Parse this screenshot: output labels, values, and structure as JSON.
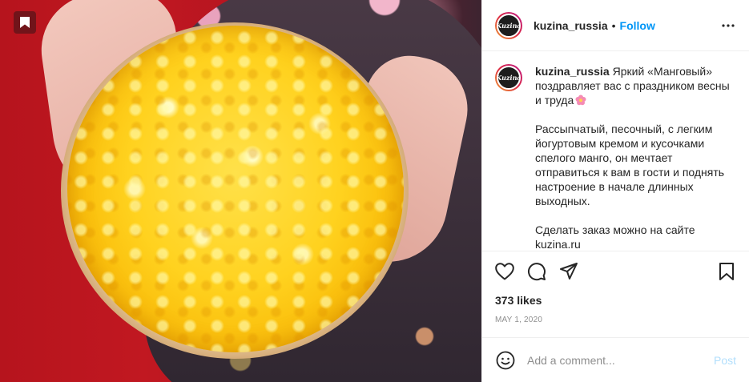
{
  "account": {
    "username": "kuzina_russia",
    "avatar_text": "Kuzina",
    "dot": "•",
    "follow_label": "Follow"
  },
  "icons": {
    "save_badge": "bookmark-icon",
    "more": "more-options-icon",
    "like": "heart-icon",
    "comment": "comment-icon",
    "share": "paper-plane-icon",
    "save": "bookmark-icon",
    "emoji": "smiley-icon",
    "caption_emoji": "flower-icon"
  },
  "caption": {
    "username": "kuzina_russia",
    "paragraphs": [
      "Яркий «Манговый» поздравляет вас с праздником весны и труда",
      "Рассыпчатый, песочный, с легким йогуртовым кремом и кусочками спелого манго, он мечтает отправиться к вам в гости и поднять настроение в начале длинных выходных.",
      "Сделать заказ можно на сайте kuzina.ru"
    ]
  },
  "stats": {
    "likes": "373 likes",
    "date": "MAY 1, 2020"
  },
  "comment_box": {
    "placeholder": "Add a comment...",
    "post_label": "Post"
  },
  "colors": {
    "link": "#0095f6",
    "post_disabled": "#b2dffc",
    "muted": "#8e8e8e"
  }
}
